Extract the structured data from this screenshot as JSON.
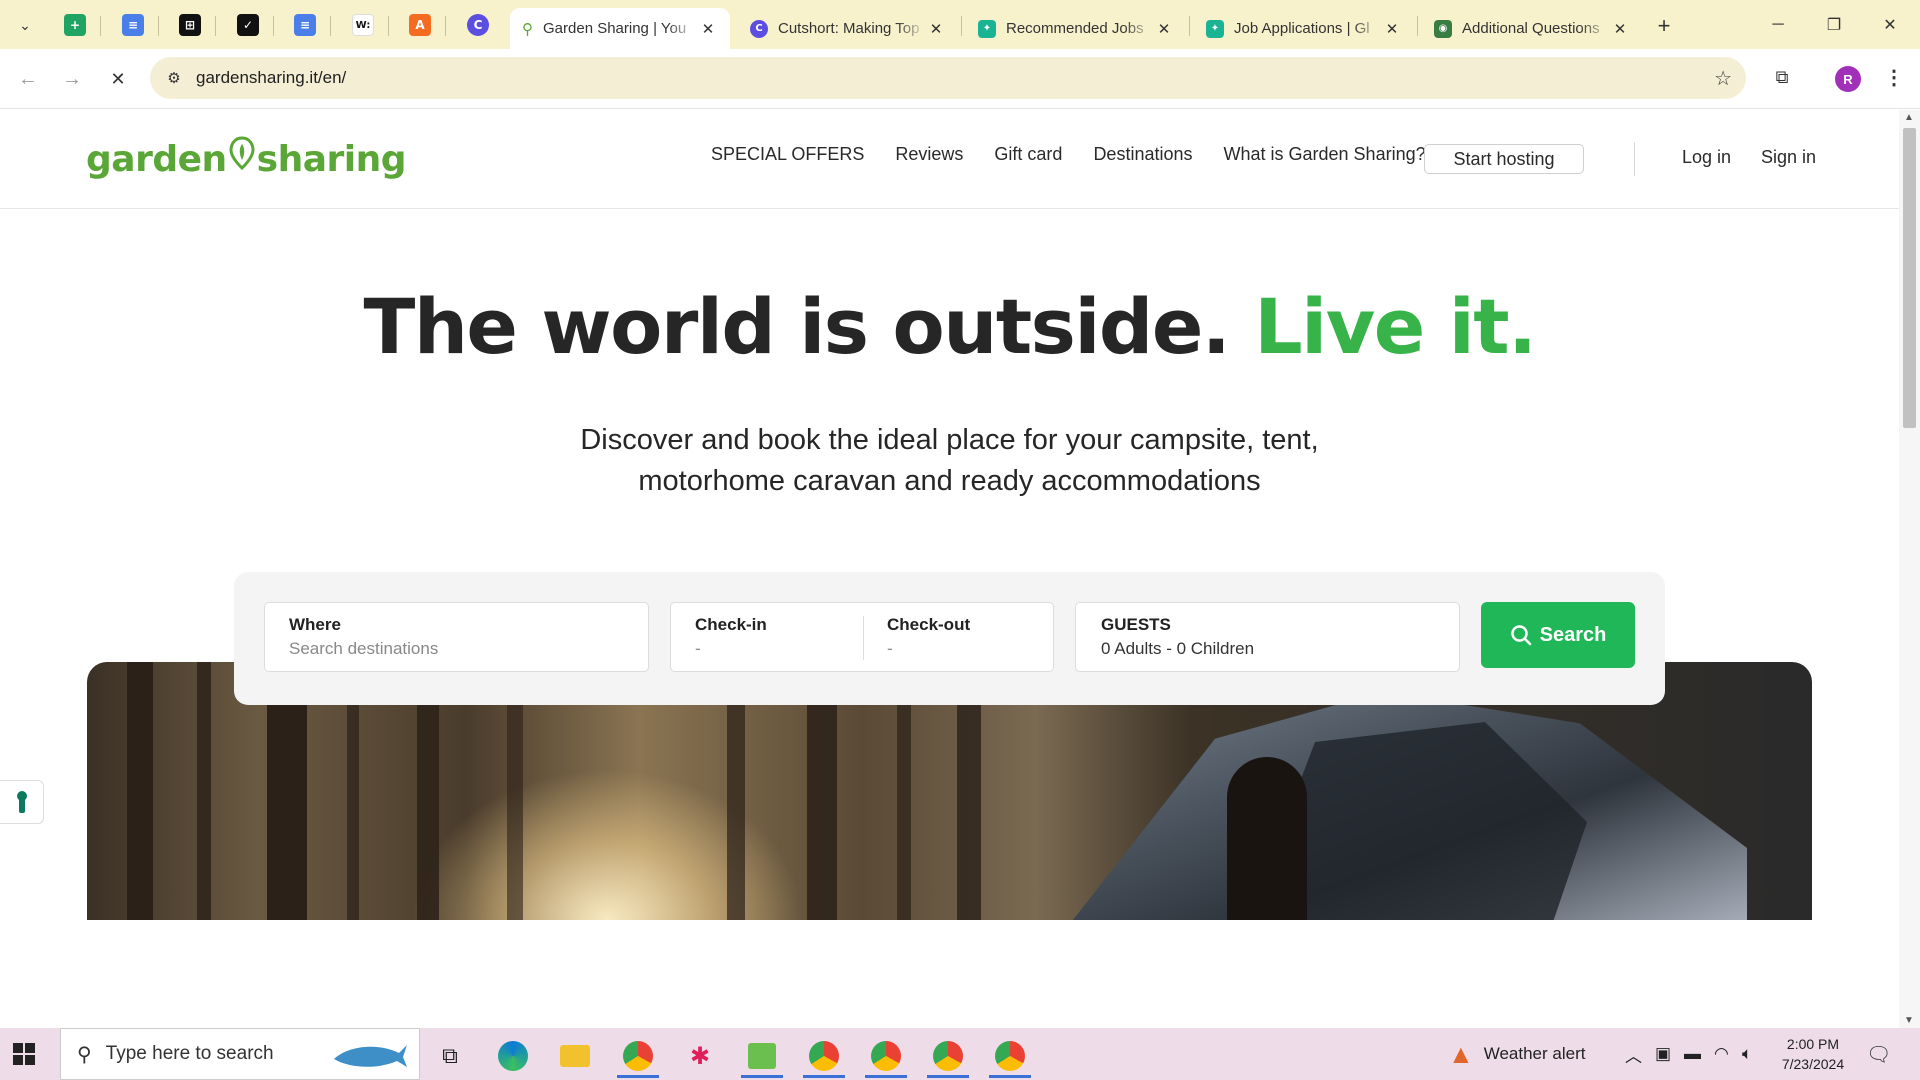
{
  "browser": {
    "tabs": [
      {
        "title": "Garden Sharing | You",
        "active": true
      },
      {
        "title": "Cutshort: Making Top",
        "active": false
      },
      {
        "title": "Recommended Jobs",
        "active": false
      },
      {
        "title": "Job Applications | Gl",
        "active": false
      },
      {
        "title": "Additional Questions",
        "active": false
      }
    ],
    "url": "gardensharing.it/en/",
    "profile_initial": "R"
  },
  "site": {
    "logo_left": "garden",
    "logo_right": "sharing",
    "nav": [
      "SPECIAL OFFERS",
      "Reviews",
      "Gift card",
      "Destinations",
      "What is Garden Sharing?"
    ],
    "start_hosting": "Start hosting",
    "login": "Log in",
    "signin": "Sign in"
  },
  "hero": {
    "title_main": "The world is outside.",
    "title_accent": "Live it.",
    "subtitle_line1": "Discover and book the ideal place for your campsite, tent,",
    "subtitle_line2": "motorhome caravan and ready accommodations"
  },
  "search": {
    "where_label": "Where",
    "where_placeholder": "Search destinations",
    "checkin_label": "Check-in",
    "checkin_value": "-",
    "checkout_label": "Check-out",
    "checkout_value": "-",
    "guests_label": "GUESTS",
    "guests_value": "0 Adults - 0 Children",
    "button": "Search"
  },
  "taskbar": {
    "search_placeholder": "Type here to search",
    "weather": "Weather alert",
    "time": "2:00 PM",
    "date": "7/23/2024"
  },
  "colors": {
    "brand_green": "#5aa637",
    "accent_green": "#37b34a",
    "search_button": "#20b758"
  }
}
